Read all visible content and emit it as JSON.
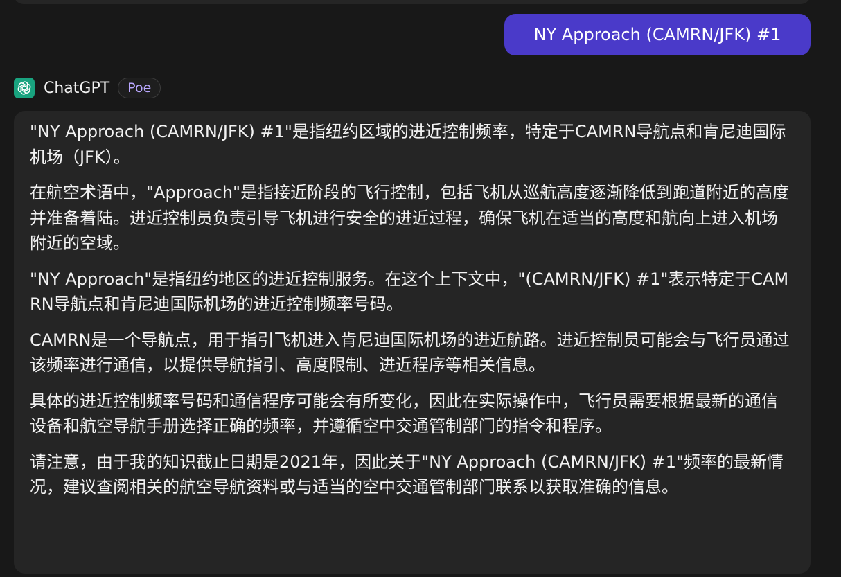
{
  "user_message": "NY Approach (CAMRN/JFK) #1",
  "bot": {
    "name": "ChatGPT",
    "badge": "Poe",
    "icon": "openai-logo-icon",
    "accent_color": "#19a37f"
  },
  "colors": {
    "user_bubble": "#4a3ac9",
    "bot_bubble": "#252525",
    "background": "#181818",
    "badge_text": "#b9a7ff"
  },
  "response": {
    "paragraphs": [
      "\"NY Approach (CAMRN/JFK) #1\"是指纽约区域的进近控制频率，特定于CAMRN导航点和肯尼迪国际机场（JFK）。",
      "在航空术语中，\"Approach\"是指接近阶段的飞行控制，包括飞机从巡航高度逐渐降低到跑道附近的高度并准备着陆。进近控制员负责引导飞机进行安全的进近过程，确保飞机在适当的高度和航向上进入机场附近的空域。",
      "\"NY Approach\"是指纽约地区的进近控制服务。在这个上下文中，\"(CAMRN/JFK) #1\"表示特定于CAMRN导航点和肯尼迪国际机场的进近控制频率号码。",
      "CAMRN是一个导航点，用于指引飞机进入肯尼迪国际机场的进近航路。进近控制员可能会与飞行员通过该频率进行通信，以提供导航指引、高度限制、进近程序等相关信息。",
      "具体的进近控制频率号码和通信程序可能会有所变化，因此在实际操作中，飞行员需要根据最新的通信设备和航空导航手册选择正确的频率，并遵循空中交通管制部门的指令和程序。",
      "请注意，由于我的知识截止日期是2021年，因此关于\"NY Approach (CAMRN/JFK) #1\"频率的最新情况，建议查阅相关的航空导航资料或与适当的空中交通管制部门联系以获取准确的信息。"
    ]
  }
}
